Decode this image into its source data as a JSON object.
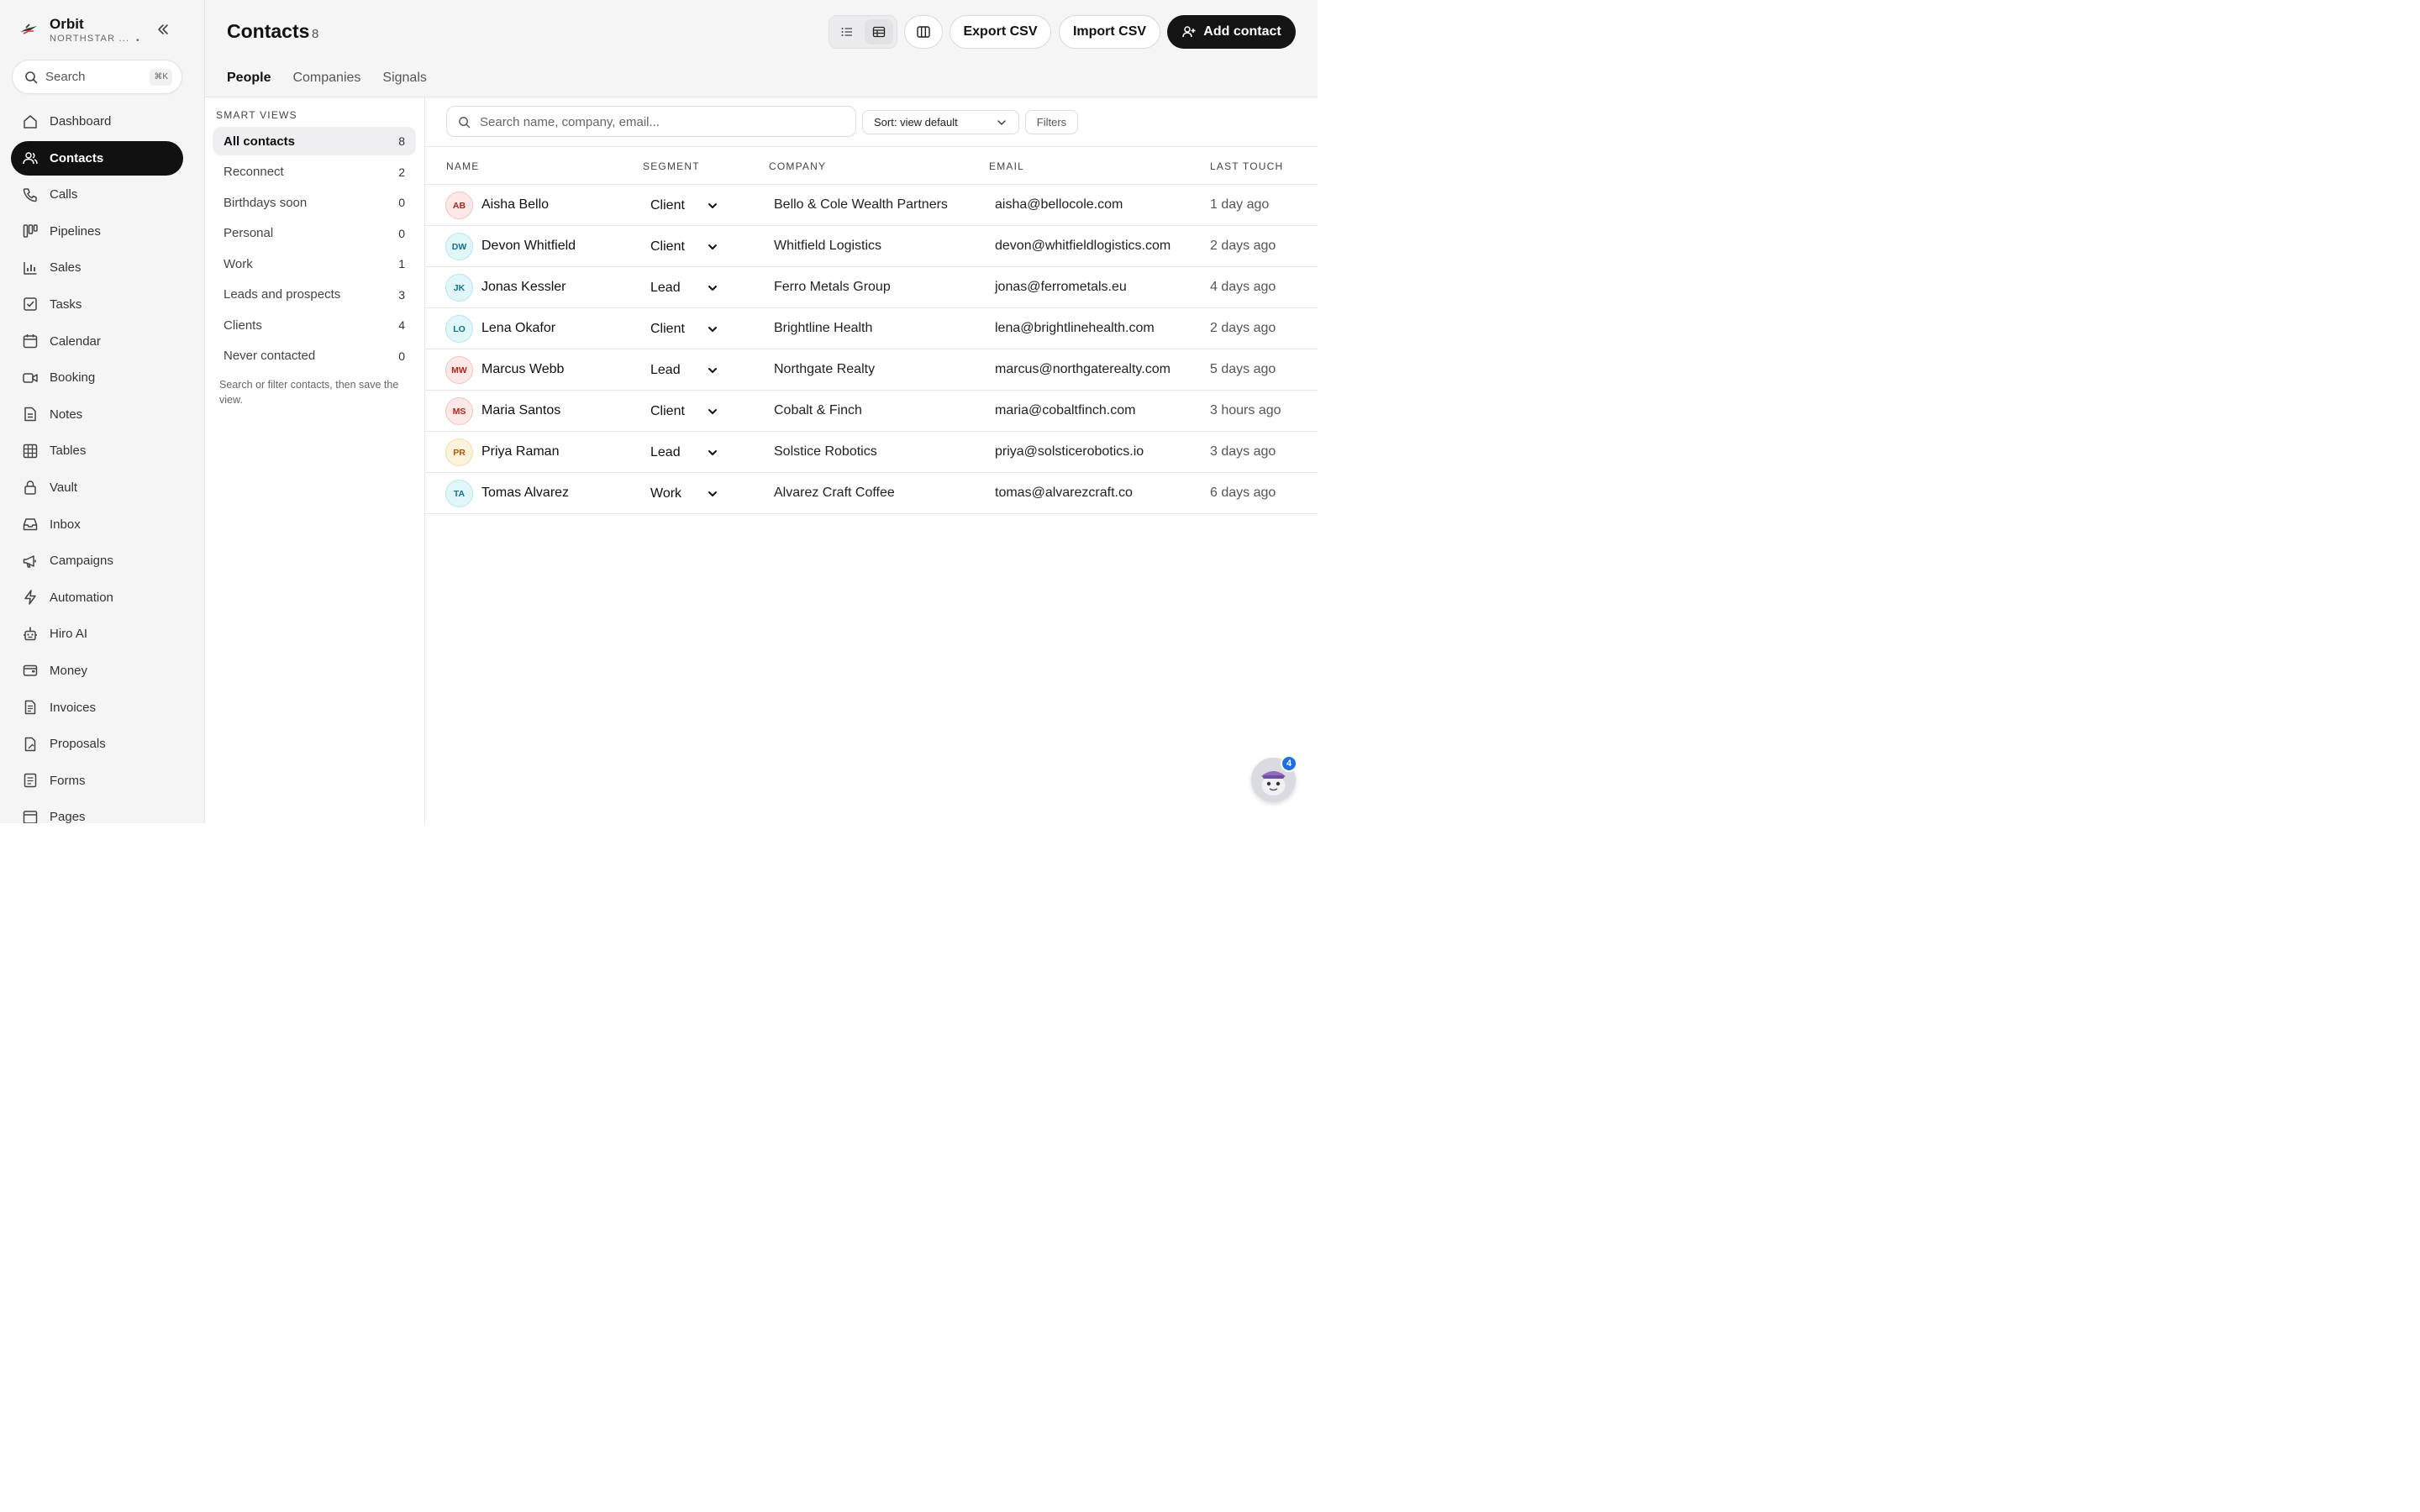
{
  "app": {
    "name": "Orbit",
    "org": "NORTHSTAR ...",
    "org_dot": "•",
    "search_placeholder": "Search",
    "search_shortcut": "⌘K"
  },
  "sidebar": {
    "items": [
      {
        "label": "Dashboard",
        "icon": "home-icon"
      },
      {
        "label": "Contacts",
        "icon": "users-icon",
        "active": true
      },
      {
        "label": "Calls",
        "icon": "phone-icon"
      },
      {
        "label": "Pipelines",
        "icon": "kanban-icon"
      },
      {
        "label": "Sales",
        "icon": "bar-chart-icon"
      },
      {
        "label": "Tasks",
        "icon": "checkbox-icon"
      },
      {
        "label": "Calendar",
        "icon": "calendar-icon"
      },
      {
        "label": "Booking",
        "icon": "video-icon"
      },
      {
        "label": "Notes",
        "icon": "note-icon"
      },
      {
        "label": "Tables",
        "icon": "grid-icon"
      },
      {
        "label": "Vault",
        "icon": "lock-icon"
      },
      {
        "label": "Inbox",
        "icon": "inbox-icon"
      },
      {
        "label": "Campaigns",
        "icon": "megaphone-icon"
      },
      {
        "label": "Automation",
        "icon": "bolt-icon"
      },
      {
        "label": "Hiro AI",
        "icon": "robot-icon"
      },
      {
        "label": "Money",
        "icon": "wallet-icon"
      },
      {
        "label": "Invoices",
        "icon": "invoice-icon"
      },
      {
        "label": "Proposals",
        "icon": "proposal-icon"
      },
      {
        "label": "Forms",
        "icon": "form-icon"
      },
      {
        "label": "Pages",
        "icon": "pages-icon"
      }
    ]
  },
  "header": {
    "title": "Contacts",
    "count": "8",
    "export_label": "Export CSV",
    "import_label": "Import CSV",
    "add_label": "Add contact",
    "tabs": [
      {
        "label": "People",
        "active": true
      },
      {
        "label": "Companies"
      },
      {
        "label": "Signals"
      }
    ]
  },
  "views": {
    "title": "SMART VIEWS",
    "items": [
      {
        "label": "All contacts",
        "count": "8",
        "active": true
      },
      {
        "label": "Reconnect",
        "count": "2"
      },
      {
        "label": "Birthdays soon",
        "count": "0"
      },
      {
        "label": "Personal",
        "count": "0"
      },
      {
        "label": "Work",
        "count": "1"
      },
      {
        "label": "Leads and prospects",
        "count": "3"
      },
      {
        "label": "Clients",
        "count": "4"
      },
      {
        "label": "Never contacted",
        "count": "0"
      }
    ],
    "hint": "Search or filter contacts, then save the view."
  },
  "toolbar": {
    "search_placeholder": "Search name, company, email...",
    "sort_label": "Sort: view default",
    "filters_label": "Filters"
  },
  "table": {
    "headers": {
      "name": "NAME",
      "segment": "SEGMENT",
      "company": "COMPANY",
      "email": "EMAIL",
      "last_touch": "LAST TOUCH"
    },
    "rows": [
      {
        "initials": "AB",
        "name": "Aisha Bello",
        "segment": "Client",
        "company": "Bello & Cole Wealth Partners",
        "email": "aisha@bellocole.com",
        "last_touch": "1 day ago",
        "avatar_bg": "#fde8e8",
        "avatar_fg": "#b42318",
        "avatar_border": "#f4c2c2"
      },
      {
        "initials": "DW",
        "name": "Devon Whitfield",
        "segment": "Client",
        "company": "Whitfield Logistics",
        "email": "devon@whitfieldlogistics.com",
        "last_touch": "2 days ago",
        "avatar_bg": "#e0f6f8",
        "avatar_fg": "#0e7490",
        "avatar_border": "#b5e6ee"
      },
      {
        "initials": "JK",
        "name": "Jonas Kessler",
        "segment": "Lead",
        "company": "Ferro Metals Group",
        "email": "jonas@ferrometals.eu",
        "last_touch": "4 days ago",
        "avatar_bg": "#e0f6f8",
        "avatar_fg": "#0e7490",
        "avatar_border": "#b5e6ee"
      },
      {
        "initials": "LO",
        "name": "Lena Okafor",
        "segment": "Client",
        "company": "Brightline Health",
        "email": "lena@brightlinehealth.com",
        "last_touch": "2 days ago",
        "avatar_bg": "#e0f6f8",
        "avatar_fg": "#0e7490",
        "avatar_border": "#b5e6ee"
      },
      {
        "initials": "MW",
        "name": "Marcus Webb",
        "segment": "Lead",
        "company": "Northgate Realty",
        "email": "marcus@northgaterealty.com",
        "last_touch": "5 days ago",
        "avatar_bg": "#fde8e8",
        "avatar_fg": "#b42318",
        "avatar_border": "#f4c2c2"
      },
      {
        "initials": "MS",
        "name": "Maria Santos",
        "segment": "Client",
        "company": "Cobalt & Finch",
        "email": "maria@cobaltfinch.com",
        "last_touch": "3 hours ago",
        "avatar_bg": "#fde8e8",
        "avatar_fg": "#b42318",
        "avatar_border": "#f4c2c2"
      },
      {
        "initials": "PR",
        "name": "Priya Raman",
        "segment": "Lead",
        "company": "Solstice Robotics",
        "email": "priya@solsticerobotics.io",
        "last_touch": "3 days ago",
        "avatar_bg": "#fdf3dc",
        "avatar_fg": "#b45309",
        "avatar_border": "#f5dea6"
      },
      {
        "initials": "TA",
        "name": "Tomas Alvarez",
        "segment": "Work",
        "company": "Alvarez Craft Coffee",
        "email": "tomas@alvarezcraft.co",
        "last_touch": "6 days ago",
        "avatar_bg": "#e0f6f8",
        "avatar_fg": "#0e7490",
        "avatar_border": "#b5e6ee"
      }
    ]
  },
  "assistant": {
    "badge": "4"
  },
  "colors": {
    "accent": "#141414",
    "badge": "#1f6fe0"
  }
}
